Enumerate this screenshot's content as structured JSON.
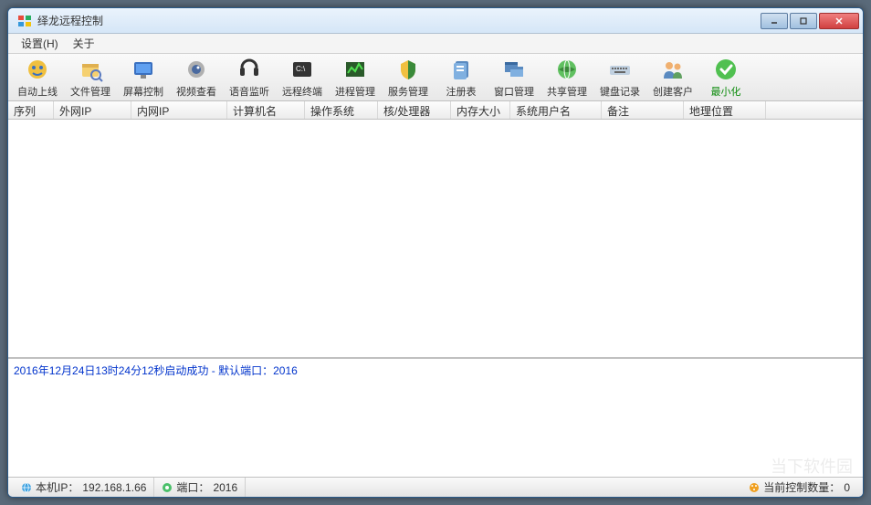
{
  "window": {
    "title": "绎龙远程控制"
  },
  "menu": {
    "settings": "设置(H)",
    "about": "关于"
  },
  "toolbar": [
    {
      "label": "自动上线",
      "name": "auto-online"
    },
    {
      "label": "文件管理",
      "name": "file-manager"
    },
    {
      "label": "屏幕控制",
      "name": "screen-control"
    },
    {
      "label": "视频查看",
      "name": "video-view"
    },
    {
      "label": "语音监听",
      "name": "audio-listen"
    },
    {
      "label": "远程终端",
      "name": "remote-terminal"
    },
    {
      "label": "进程管理",
      "name": "process-manager"
    },
    {
      "label": "服务管理",
      "name": "service-manager"
    },
    {
      "label": "注册表",
      "name": "registry"
    },
    {
      "label": "窗口管理",
      "name": "window-manager"
    },
    {
      "label": "共享管理",
      "name": "share-manager"
    },
    {
      "label": "键盘记录",
      "name": "keylogger"
    },
    {
      "label": "创建客户",
      "name": "create-client"
    },
    {
      "label": "最小化",
      "name": "minimize-app",
      "green": true
    }
  ],
  "columns": [
    {
      "label": "序列",
      "w": 50
    },
    {
      "label": "外网IP",
      "w": 85
    },
    {
      "label": "内网IP",
      "w": 105
    },
    {
      "label": "计算机名",
      "w": 85
    },
    {
      "label": "操作系统",
      "w": 80
    },
    {
      "label": "核/处理器",
      "w": 80
    },
    {
      "label": "内存大小",
      "w": 65
    },
    {
      "label": "系统用户名",
      "w": 100
    },
    {
      "label": "备注",
      "w": 90
    },
    {
      "label": "地理位置",
      "w": 90
    }
  ],
  "log": {
    "line1": "2016年12月24日13时24分12秒启动成功 - 默认端口：2016"
  },
  "status": {
    "local_ip_label": "本机IP：",
    "local_ip_value": "192.168.1.66",
    "port_label": "端口：",
    "port_value": "2016",
    "count_label": "当前控制数量：",
    "count_value": "0"
  },
  "watermark": "当下软件园"
}
